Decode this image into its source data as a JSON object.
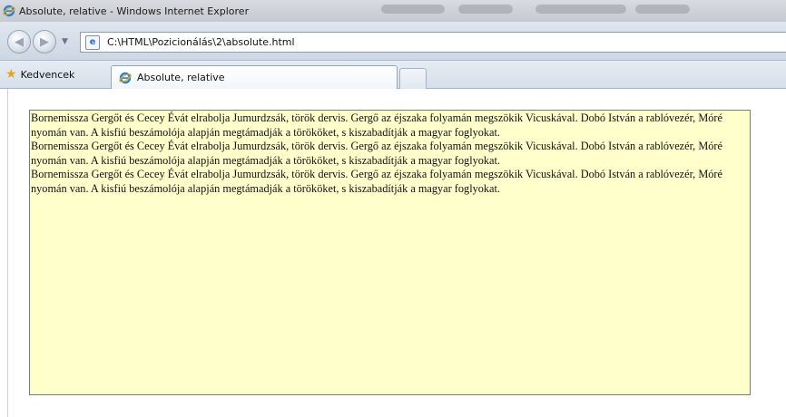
{
  "window": {
    "title": "Absolute, relative - Windows Internet Explorer"
  },
  "address": {
    "url": "C:\\HTML\\Pozicionálás\\2\\absolute.html"
  },
  "favorites": {
    "label": "Kedvencek"
  },
  "tabs": [
    {
      "label": "Absolute, relative",
      "active": true
    }
  ],
  "content": {
    "paragraphs": [
      "Bornemissza Gergőt és Cecey Évát elrabolja Jumurdzsák, török dervis. Gergő az éjszaka folyamán megszökik Vicuskával. Dobó István a rablóvezér, Móré nyomán van. A kisfiú beszámolója alapján megtámadják a törököket, s kiszabadítják a magyar foglyokat.",
      "Bornemissza Gergőt és Cecey Évát elrabolja Jumurdzsák, török dervis. Gergő az éjszaka folyamán megszökik Vicuskával. Dobó István a rablóvezér, Móré nyomán van. A kisfiú beszámolója alapján megtámadják a törököket, s kiszabadítják a magyar foglyokat.",
      "Bornemissza Gergőt és Cecey Évát elrabolja Jumurdzsák, török dervis. Gergő az éjszaka folyamán megszökik Vicuskával. Dobó István a rablóvezér, Móré nyomán van. A kisfiú beszámolója alapján megtámadják a törököket, s kiszabadítják a magyar foglyokat."
    ],
    "box_background": "#ffffcc"
  },
  "icons": {
    "app": "ie-icon",
    "back": "back-arrow-icon",
    "forward": "forward-arrow-icon",
    "page": "ie-page-icon",
    "favorites": "star-icon"
  }
}
